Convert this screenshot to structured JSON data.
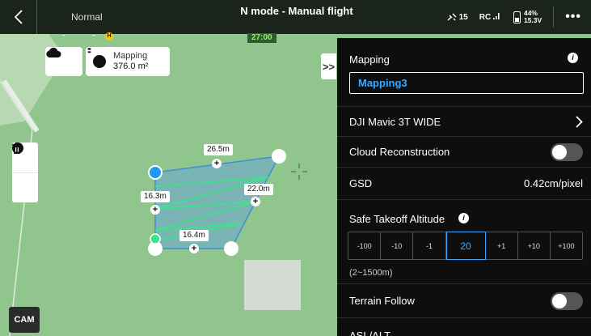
{
  "topbar": {
    "mode": "Normal",
    "flight_title": "N mode - Manual flight",
    "timer": "27:00",
    "satellites": "15",
    "rc_label": "RC",
    "battery_percent": "44%",
    "battery_voltage": "15.3V",
    "more": "•••"
  },
  "map": {
    "area_label": "Mapping",
    "area_value": "376.0 m²",
    "collapse_symbol": ">>",
    "cam_label": "CAM",
    "distances": [
      "26.5m",
      "22.0m",
      "16.3m",
      "16.4m"
    ],
    "home_marker": "H"
  },
  "panel": {
    "mapping_title": "Mapping",
    "mapping_name": "Mapping3",
    "camera": "DJI Mavic 3T WIDE",
    "cloud_reconstruction": "Cloud Reconstruction",
    "cloud_reconstruction_on": false,
    "gsd_label": "GSD",
    "gsd_value": "0.42cm/pixel",
    "safe_takeoff_label": "Safe Takeoff Altitude",
    "steps": [
      "-100",
      "-10",
      "-1",
      "20",
      "+1",
      "+10",
      "+100"
    ],
    "current_step_index": 3,
    "range": "(2~1500m)",
    "terrain_follow": "Terrain Follow",
    "terrain_follow_on": false,
    "asl_alt": "ASL/ALT"
  },
  "colors": {
    "accent_blue": "#3ea8ff",
    "map_green": "#90c58e",
    "route_green": "#41e08a",
    "polygon_fill": "#6aa6d6"
  }
}
